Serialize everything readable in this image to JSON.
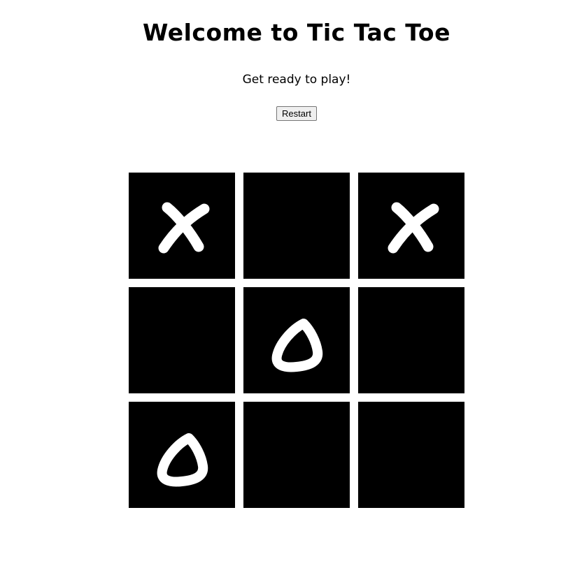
{
  "header": {
    "title": "Welcome to Tic Tac Toe",
    "status": "Get ready to play!"
  },
  "controls": {
    "restart_label": "Restart"
  },
  "board": {
    "cells": [
      "X",
      "",
      "X",
      "",
      "O",
      "",
      "O",
      "",
      ""
    ]
  },
  "colors": {
    "cell_background": "#000000",
    "mark": "#ffffff",
    "page_background": "#ffffff"
  }
}
